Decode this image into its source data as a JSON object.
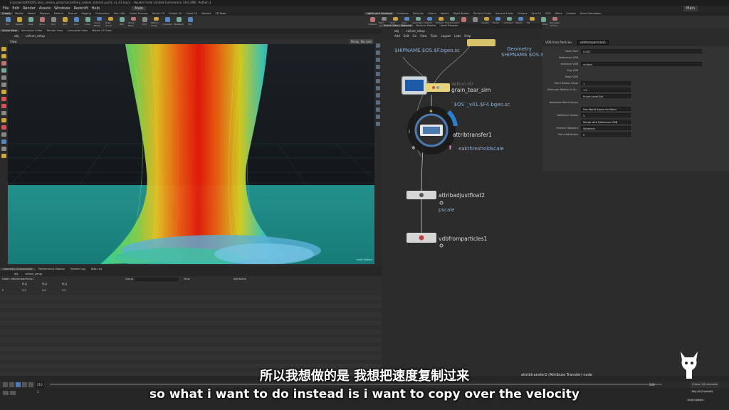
{
  "window": {
    "title": "E:/projects/KXGOS_fairy_vellum_grain/cache/fairy_vellum_tutorial_part2_v1_02.hipnc - Houdini Indie Limited-Commercial 19.0.498 - Python 3",
    "menu": [
      "File",
      "Edit",
      "Render",
      "Assets",
      "Windows",
      "Redshift",
      "Help"
    ],
    "desktop": "Main",
    "desktop_right": "Main"
  },
  "shelf_tabs_left": [
    "Create",
    "Modify",
    "Model",
    "Polygon",
    "Deform",
    "Texture",
    "Rigging",
    "Characters",
    "Hair Utils",
    "Guide Process",
    "Terrain FX",
    "Simple FX",
    "Cloud FX",
    "Volume",
    "TD Tools"
  ],
  "shelf_tabs_right": [
    "Lights and Cameras",
    "Collisions",
    "Particles",
    "Grains",
    "Vellum",
    "Rigid Bodies",
    "Particle Fluids",
    "Viscous Fluids",
    "Oceans",
    "Pyro FX",
    "FEM",
    "Wires",
    "Crowds",
    "Drive Simulation"
  ],
  "shelf_tools_left": [
    "Box",
    "Sphere",
    "Tube",
    "Torus",
    "Grid",
    "Null",
    "Line",
    "Circle",
    "Curve Bezier",
    "Draw Curve",
    "Path",
    "Spray Paint",
    "Font",
    "Platonic Solids",
    "L-System",
    "Metaball",
    "File"
  ],
  "shelf_tools_right": [
    "Camera",
    "Point Light",
    "Spot Light",
    "Area Light",
    "Geometry Light",
    "Volume Light",
    "Distant Light",
    "Environment Light",
    "Sky Light",
    "GI Light",
    "Caustic Light",
    "Portal Light",
    "Ambient Light",
    "Stereo Camera",
    "VR Camera",
    "Switcher",
    "Gamepad Camera"
  ],
  "viewport": {
    "tabs": [
      "Scene View",
      "Animation Editor",
      "Render View",
      "Composite View",
      "Motion FX View"
    ],
    "path": "obj",
    "node": "vellum_setup",
    "label": "View",
    "camera": "Persp",
    "cam_menu": "No cam",
    "corner_label": "Indie Edition"
  },
  "spreadsheet": {
    "tabs": [
      "Geometry Spreadsheet",
      "Performance Monitor",
      "Render Log",
      "Take List"
    ],
    "path": "obj",
    "node": "vellum_setup",
    "node_label": "Node: vdbfromparticles1",
    "group_label": "Group",
    "view_label": "View",
    "attributes_label": "Attributes",
    "columns": [
      "",
      "P[x]",
      "P[y]",
      "P[z]"
    ],
    "rows": [
      [
        "0",
        "0.0",
        "0.0",
        "0.0"
      ]
    ]
  },
  "network": {
    "tabs": [
      "Scene View / Network",
      "Material Palette",
      "Asset Browser"
    ],
    "path": "obj",
    "node": "vellum_setup",
    "menu": [
      "Add",
      "Edit",
      "Go",
      "View",
      "Tools",
      "Layout",
      "Labs",
      "Help"
    ],
    "nodes": [
      {
        "name": "grain_tear_sim",
        "type": "Vellum I/O",
        "param": "`$OS`_v01.$F4.bgeo.sc"
      },
      {
        "name": "attribtransfer1",
        "param": "eakthresholdscale"
      },
      {
        "name": "attribadjustfloat2",
        "param": "pscale"
      },
      {
        "name": "vdbfromparticles1",
        "param": ""
      }
    ],
    "top_texts": [
      "$HIPNAME.$OS.$F.bgeo.sc",
      "Geometry",
      "$HIPNAME.$OS.$"
    ],
    "footer_status": "attribtransfer1 (Attribute Transfer) node"
  },
  "params": {
    "title": "VDB from Particles",
    "node_name": "vdbfromparticles1",
    "rows": [
      {
        "label": "Voxel Size",
        "value": "0.007"
      },
      {
        "label": "Reference VDB",
        "value": ""
      },
      {
        "label": "Distance VDB",
        "value": "surface"
      },
      {
        "label": "Fog VDB",
        "value": ""
      },
      {
        "label": "Mask VDB",
        "value": ""
      },
      {
        "label": "Point Radius Scale",
        "value": "1"
      },
      {
        "label": "Minimum Radius in Vo...",
        "value": "1.5"
      },
      {
        "label": "",
        "value": "Prune Level Set"
      },
      {
        "label": "Rasterize World Space",
        "value": ""
      },
      {
        "label": "",
        "value": "Use World Space for Band"
      },
      {
        "label": "Half Band Voxels",
        "value": "3"
      },
      {
        "label": "",
        "value": "Merge with Reference VDB"
      },
      {
        "label": "Particle Footprint",
        "value": "Spherical"
      },
      {
        "label": "Point Attributes",
        "value": "0"
      }
    ]
  },
  "timeline": {
    "frame": "210",
    "end_frame": "240",
    "start_frame": "1",
    "keys_label": "0 keys, 0/0 channels",
    "key_all": "Key All Channels",
    "auto_update": "Auto Update"
  },
  "subtitles": {
    "chinese": "所以我想做的是 我想把速度复制过来",
    "english": "so what i want to do instead is i want to copy over the velocity"
  },
  "colors": {
    "bg": "#2b2b2b",
    "viewport_bg": "#151a1e",
    "ground": "#1c8a86",
    "node_path": "#8ab0d8"
  }
}
